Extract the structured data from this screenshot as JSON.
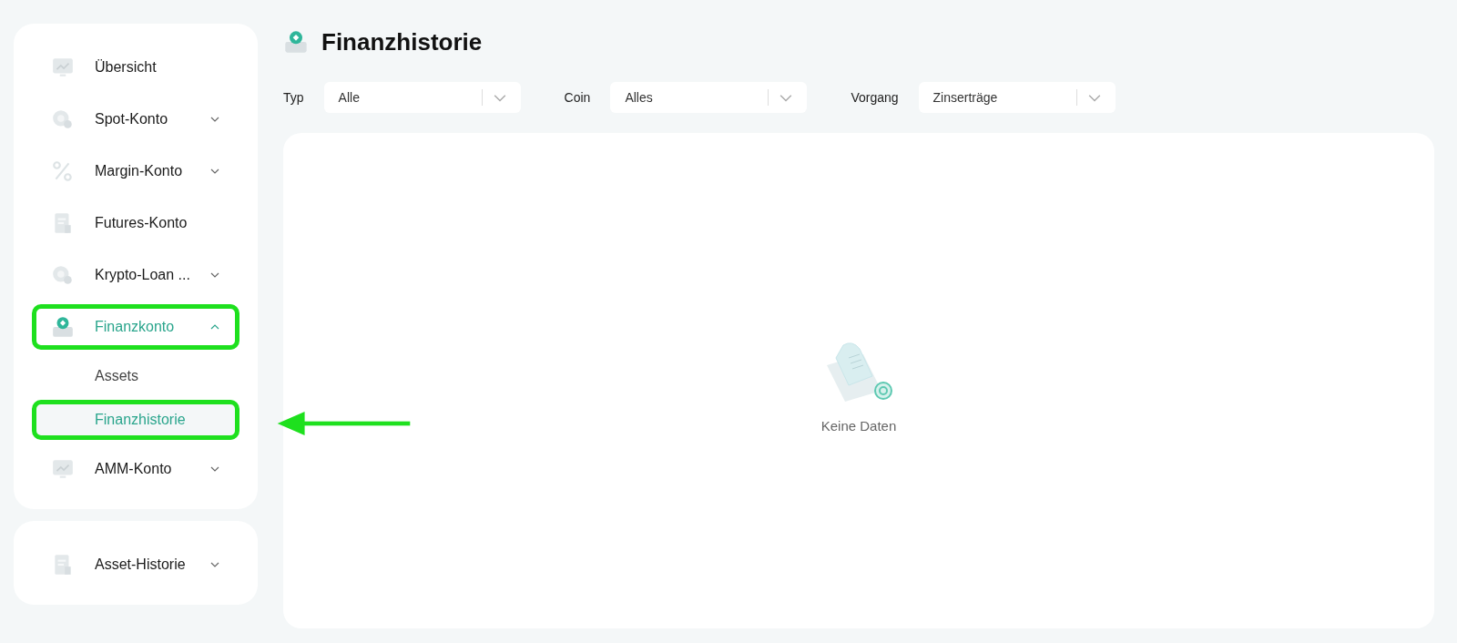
{
  "sidebar": {
    "groups": [
      {
        "items": [
          {
            "label": "Übersicht",
            "expandable": false,
            "expanded": false,
            "selected": false,
            "highlighted": false
          },
          {
            "label": "Spot-Konto",
            "expandable": true,
            "expanded": false,
            "selected": false,
            "highlighted": false
          },
          {
            "label": "Margin-Konto",
            "expandable": true,
            "expanded": false,
            "selected": false,
            "highlighted": false
          },
          {
            "label": "Futures-Konto",
            "expandable": false,
            "expanded": false,
            "selected": false,
            "highlighted": false
          },
          {
            "label": "Krypto-Loan ...",
            "expandable": true,
            "expanded": false,
            "selected": false,
            "highlighted": false
          },
          {
            "label": "Finanzkonto",
            "expandable": true,
            "expanded": true,
            "selected": true,
            "highlighted": true,
            "children": [
              {
                "label": "Assets",
                "selected": false,
                "highlighted": false
              },
              {
                "label": "Finanzhistorie",
                "selected": true,
                "highlighted": true
              }
            ]
          },
          {
            "label": "AMM-Konto",
            "expandable": true,
            "expanded": false,
            "selected": false,
            "highlighted": false
          }
        ]
      },
      {
        "items": [
          {
            "label": "Asset-Historie",
            "expandable": true,
            "expanded": false,
            "selected": false,
            "highlighted": false
          }
        ]
      }
    ]
  },
  "page": {
    "title": "Finanzhistorie"
  },
  "filters": [
    {
      "label": "Typ",
      "value": "Alle"
    },
    {
      "label": "Coin",
      "value": "Alles"
    },
    {
      "label": "Vorgang",
      "value": "Zinserträge"
    }
  ],
  "empty_state": {
    "message": "Keine Daten"
  },
  "annotation": {
    "arrow": true
  }
}
